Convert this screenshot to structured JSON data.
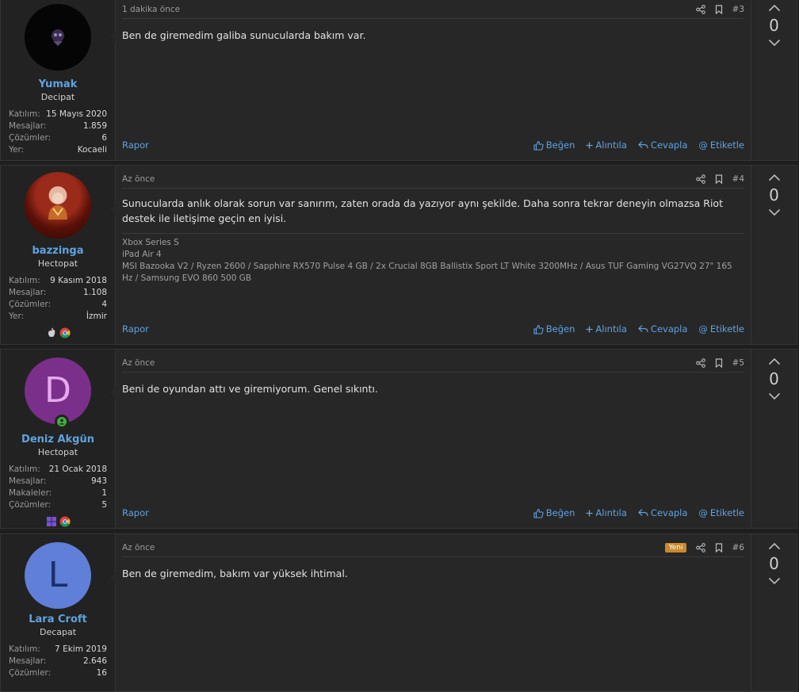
{
  "posts": [
    {
      "time": "1 dakika önce",
      "number": "#3",
      "is_new": false,
      "body": "Ben de giremedim galiba sunucularda bakım var.",
      "signature": [],
      "user": {
        "name": "Yumak",
        "title": "Decipat",
        "stats": [
          {
            "key": "Katılım:",
            "val": "15 Mayıs 2020"
          },
          {
            "key": "Mesajlar:",
            "val": "1.859"
          },
          {
            "key": "Çözümler:",
            "val": "6"
          },
          {
            "key": "Yer:",
            "val": "Kocaeli"
          }
        ]
      },
      "votes": "0"
    },
    {
      "time": "Az önce",
      "number": "#4",
      "is_new": false,
      "body": "Sunucularda anlık olarak sorun var sanırım, zaten orada da yazıyor aynı şekilde. Daha sonra tekrar deneyin olmazsa Riot destek ile iletişime geçin en iyisi.",
      "signature": [
        "Xbox Series S",
        "iPad Air 4",
        "MSI Bazooka V2 / Ryzen 2600 / Sapphire RX570 Pulse 4 GB / 2x Crucial 8GB Ballistix Sport LT White 3200MHz / Asus TUF Gaming VG27VQ 27\" 165 Hz / Samsung EVO 860 500 GB"
      ],
      "user": {
        "name": "bazzinga",
        "title": "Hectopat",
        "stats": [
          {
            "key": "Katılım:",
            "val": "9 Kasım 2018"
          },
          {
            "key": "Mesajlar:",
            "val": "1.108"
          },
          {
            "key": "Çözümler:",
            "val": "4"
          },
          {
            "key": "Yer:",
            "val": "İzmir"
          }
        ]
      },
      "votes": "0"
    },
    {
      "time": "Az önce",
      "number": "#5",
      "is_new": false,
      "body": "Beni de oyundan attı ve giremiyorum. Genel sıkıntı.",
      "signature": [],
      "user": {
        "name": "Deniz Akgün",
        "title": "Hectopat",
        "avatar_letter": "D",
        "stats": [
          {
            "key": "Katılım:",
            "val": "21 Ocak 2018"
          },
          {
            "key": "Mesajlar:",
            "val": "943"
          },
          {
            "key": "Makaleler:",
            "val": "1"
          },
          {
            "key": "Çözümler:",
            "val": "5"
          }
        ]
      },
      "votes": "0"
    },
    {
      "time": "Az önce",
      "number": "#6",
      "is_new": true,
      "new_label": "Yeni",
      "body": "Ben de giremedim, bakım var yüksek ihtimal.",
      "signature": [],
      "user": {
        "name": "Lara Croft",
        "title": "Decapat",
        "avatar_letter": "L",
        "stats": [
          {
            "key": "Katılım:",
            "val": "7 Ekim 2019"
          },
          {
            "key": "Mesajlar:",
            "val": "2.646"
          },
          {
            "key": "Çözümler:",
            "val": "16"
          }
        ]
      },
      "votes": "0"
    }
  ],
  "labels": {
    "report": "Rapor",
    "like": "Beğen",
    "quote": "Alıntıla",
    "reply": "Cevapla",
    "tag": "Etiketle"
  },
  "colors": {
    "link": "#5fa3e0",
    "new_badge": "#c98a2c",
    "avatar_d": "#7a2f8a",
    "avatar_l": "#5f7fd8",
    "online": "#3bb03b"
  },
  "icons": {
    "share": "share-icon",
    "bookmark": "bookmark-icon",
    "upvote": "chevron-up-icon",
    "downvote": "chevron-down-icon",
    "like": "thumbs-up-icon",
    "quote": "plus-icon",
    "reply": "reply-icon",
    "tag": "at-icon"
  }
}
